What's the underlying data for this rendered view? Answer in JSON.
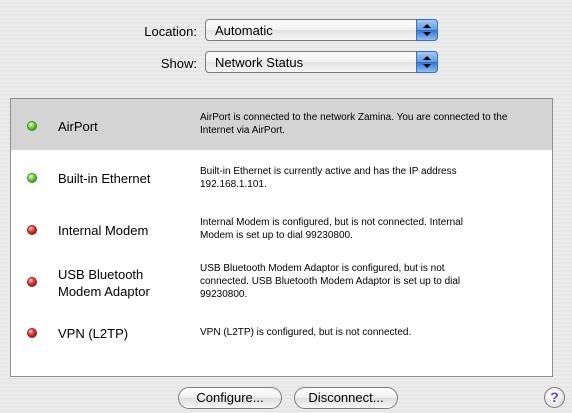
{
  "location": {
    "label": "Location:",
    "value": "Automatic"
  },
  "show": {
    "label": "Show:",
    "value": "Network Status"
  },
  "services": [
    {
      "name": "AirPort",
      "status": "green",
      "description": "AirPort is connected to the network Zamina. You are connected to the Internet via AirPort."
    },
    {
      "name": "Built-in Ethernet",
      "status": "green",
      "description": "Built-in Ethernet is currently active and has the IP address 192.168.1.101."
    },
    {
      "name": "Internal Modem",
      "status": "red",
      "description": "Internal Modem is configured, but is not connected. Internal Modem is set up to dial 99230800."
    },
    {
      "name": "USB Bluetooth Modem Adaptor",
      "status": "red",
      "description": "USB Bluetooth Modem Adaptor is configured, but is not connected. USB Bluetooth Modem Adaptor is set up to dial 99230800."
    },
    {
      "name": "VPN (L2TP)",
      "status": "red",
      "description": "VPN (L2TP) is configured, but is not connected."
    }
  ],
  "buttons": {
    "configure": "Configure...",
    "disconnect": "Disconnect...",
    "help": "?"
  },
  "colors": {
    "selected_row": "#d4d4d4",
    "status_green": "#4cc62a",
    "status_red": "#d81f1f",
    "popup_arrows": "#2b71d8"
  }
}
